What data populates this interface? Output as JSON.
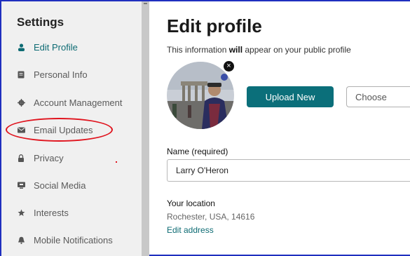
{
  "sidebar": {
    "heading": "Settings",
    "items": [
      {
        "label": "Edit Profile",
        "icon": "person-icon",
        "active": true
      },
      {
        "label": "Personal Info",
        "icon": "document-icon"
      },
      {
        "label": "Account Management",
        "icon": "gear-icon"
      },
      {
        "label": "Email Updates",
        "icon": "envelope-icon"
      },
      {
        "label": "Privacy",
        "icon": "lock-icon"
      },
      {
        "label": "Social Media",
        "icon": "monitor-icon"
      },
      {
        "label": "Interests",
        "icon": "star-icon"
      },
      {
        "label": "Mobile Notifications",
        "icon": "bell-icon"
      }
    ]
  },
  "main": {
    "title": "Edit profile",
    "subtitle_pre": "This information ",
    "subtitle_bold": "will",
    "subtitle_post": " appear on your public profile",
    "avatar_remove": "×",
    "upload_label": "Upload New",
    "choose_label": "Choose",
    "name_label": "Name (required)",
    "name_value": "Larry O'Heron",
    "location_label": "Your location",
    "location_value": "Rochester, USA, 14616",
    "edit_address": "Edit address"
  },
  "colors": {
    "accent": "#0b6f7a",
    "annotation": "#e0141e",
    "sidebar_bg": "#f0f0f0"
  }
}
